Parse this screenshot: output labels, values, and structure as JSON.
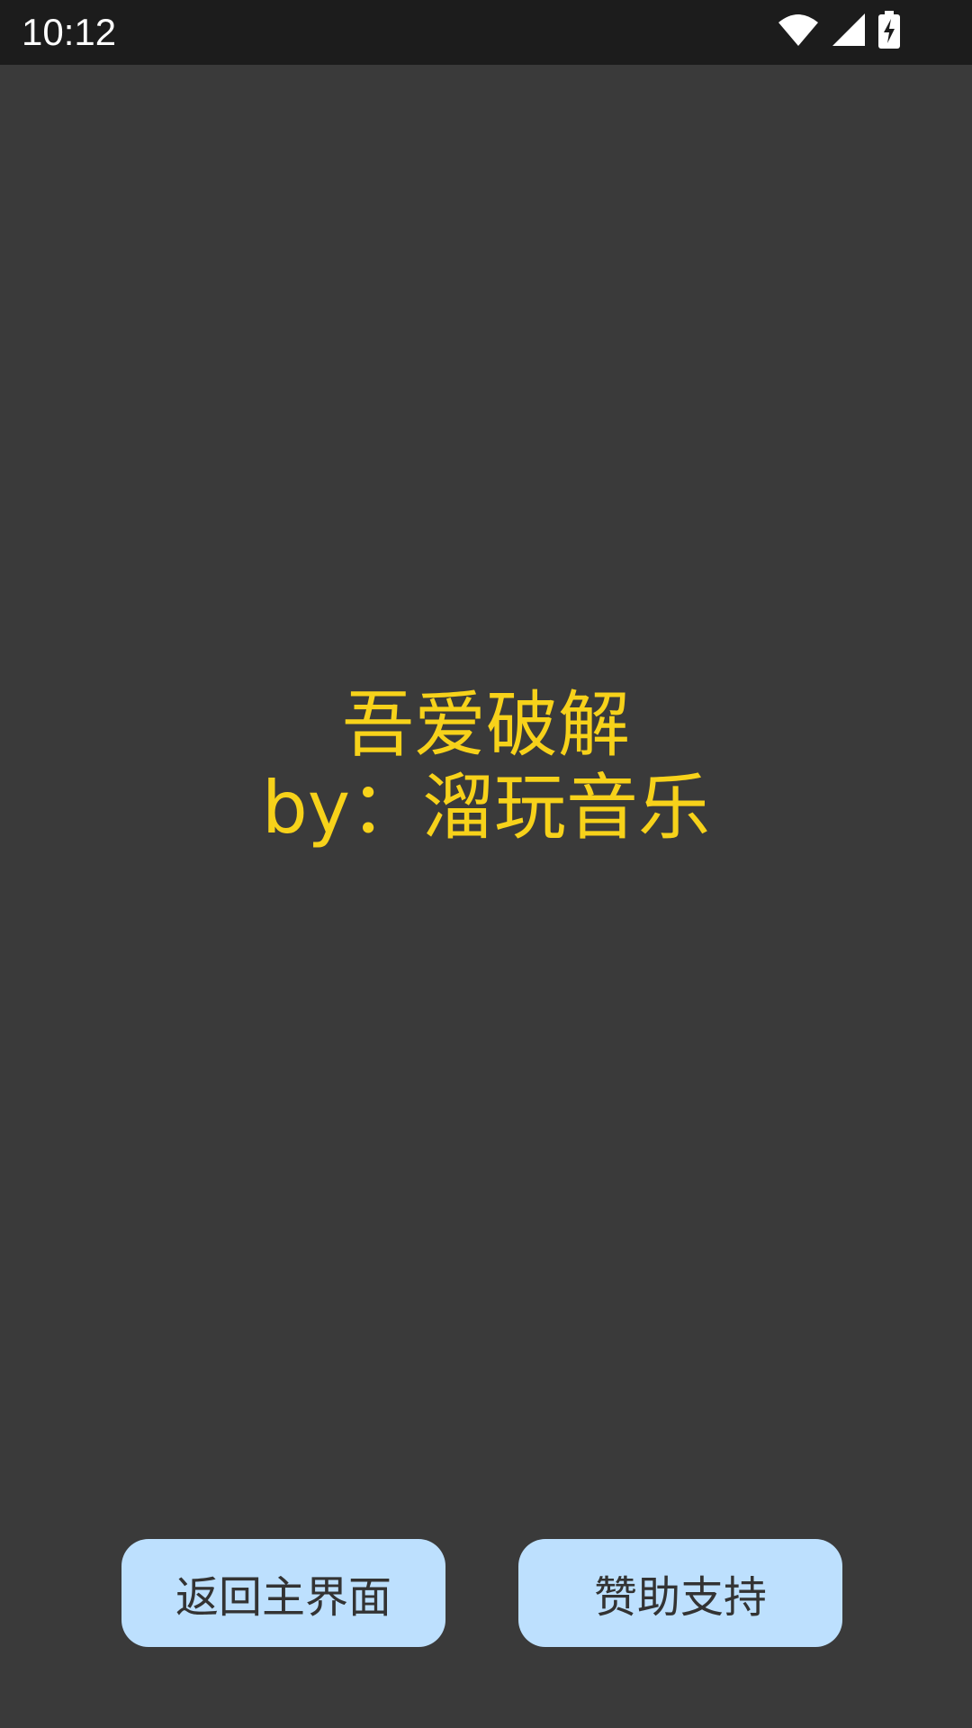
{
  "status_bar": {
    "time": "10:12",
    "icons": [
      "wifi-icon",
      "signal-icon",
      "battery-charging-icon"
    ]
  },
  "main": {
    "title_line": "吾爱破解",
    "author_line": "by：溜玩音乐",
    "text_color": "#f7d21a",
    "background": "#3a3a3a"
  },
  "buttons": {
    "back_home_label": "返回主界面",
    "sponsor_label": "赞助支持",
    "button_color": "#bde0fe"
  }
}
